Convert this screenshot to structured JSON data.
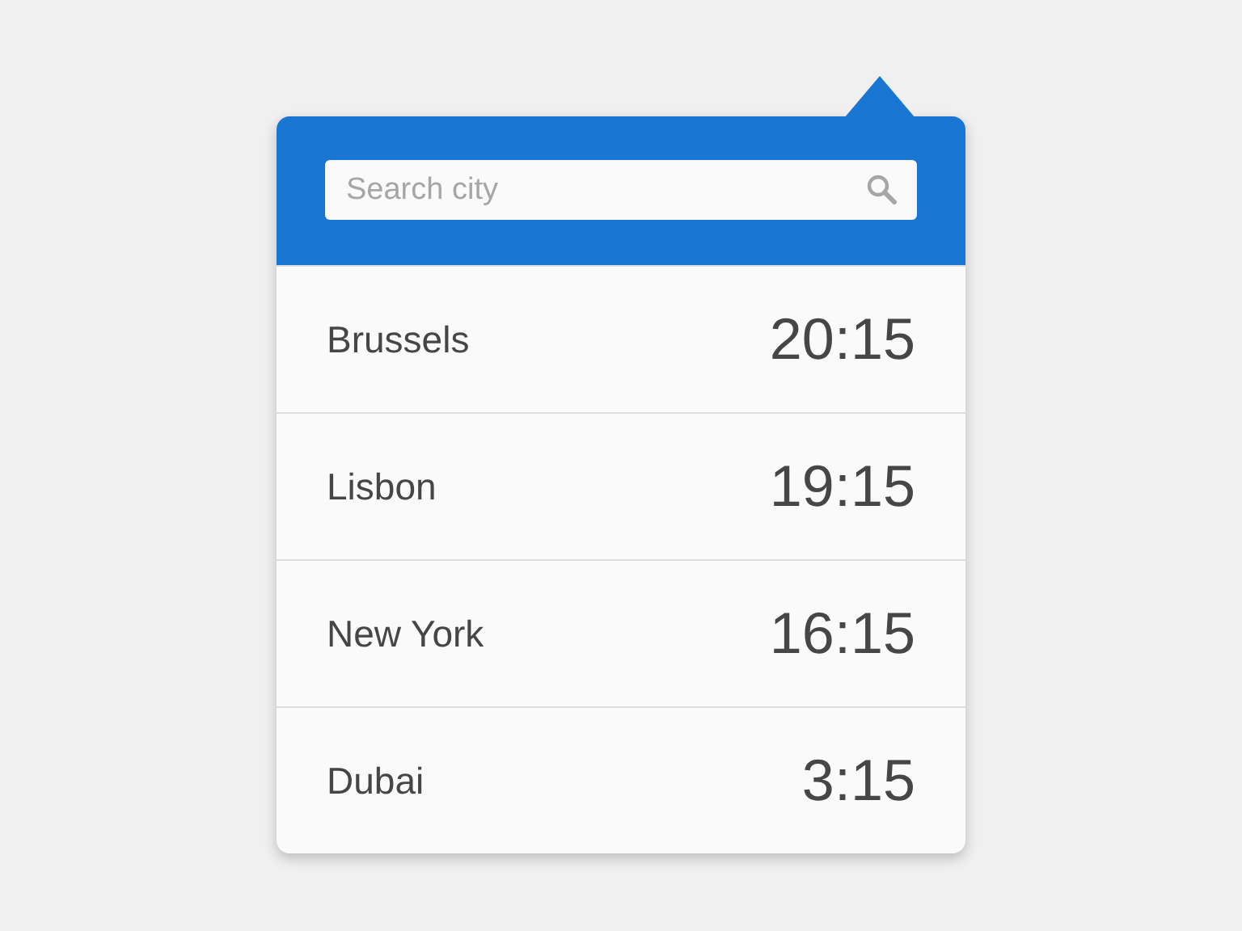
{
  "search": {
    "placeholder": "Search city"
  },
  "cities": [
    {
      "name": "Brussels",
      "time": "20:15"
    },
    {
      "name": "Lisbon",
      "time": "19:15"
    },
    {
      "name": "New York",
      "time": "16:15"
    },
    {
      "name": "Dubai",
      "time": "3:15"
    }
  ]
}
